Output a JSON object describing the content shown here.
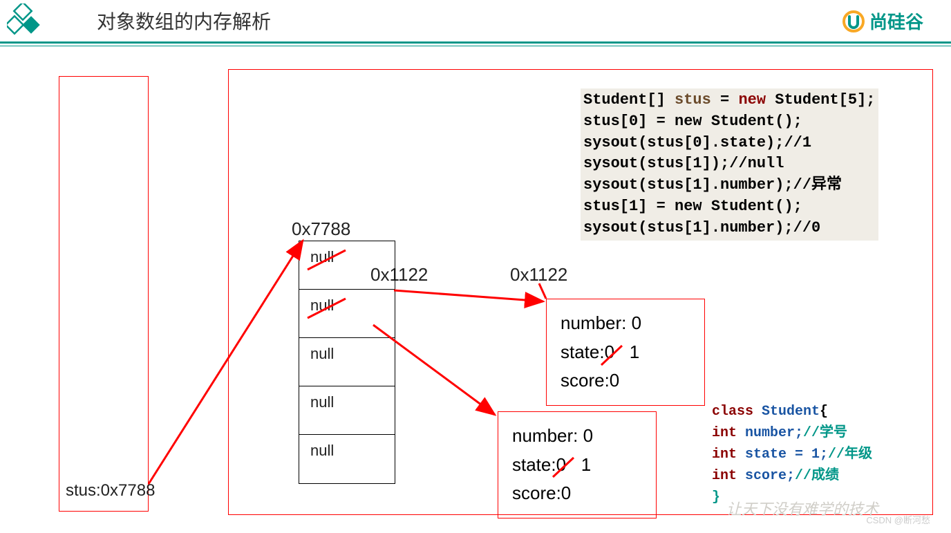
{
  "header": {
    "title": "对象数组的内存解析",
    "brand": "尚硅谷"
  },
  "stack": {
    "label": "stus:0x7788"
  },
  "addresses": {
    "arrayAddr": "0x7788",
    "objAddrA": "0x1122",
    "objAddrB": "0x1122"
  },
  "arrayCells": [
    "null",
    "null",
    "null",
    "null",
    "null"
  ],
  "object1": {
    "line1": "number: 0",
    "line2_pre": "state:",
    "line2_old": "0",
    "line2_new": "1",
    "line3": "score:0"
  },
  "object2": {
    "line1": "number: 0",
    "line2_pre": "state:",
    "line2_old": "0",
    "line2_new": "1",
    "line3": "score:0"
  },
  "code1": {
    "l1a": "Student[] ",
    "l1b": "stus",
    "l1c": " = ",
    "l1d": "new ",
    "l1e": "Student[5];",
    "l2": "stus[0] = new Student();",
    "l3": "sysout(stus[0].state);//1",
    "l4": "sysout(stus[1]);//null",
    "l5": "sysout(stus[1].number);//异常",
    "l6": "stus[1] = new Student();",
    "l7": "sysout(stus[1].number);//0"
  },
  "code2": {
    "l1a": "class ",
    "l1b": "Student",
    "l1c": "{",
    "l2a": "int ",
    "l2b": "number;",
    "l2c": "//学号",
    "l3a": "int ",
    "l3b": "state = 1;",
    "l3c": "//年级",
    "l4a": "int ",
    "l4b": "score;",
    "l4c": "//成绩",
    "l5": "}"
  },
  "slogan": "让天下没有难学的技术",
  "watermark": "CSDN @断河愁"
}
